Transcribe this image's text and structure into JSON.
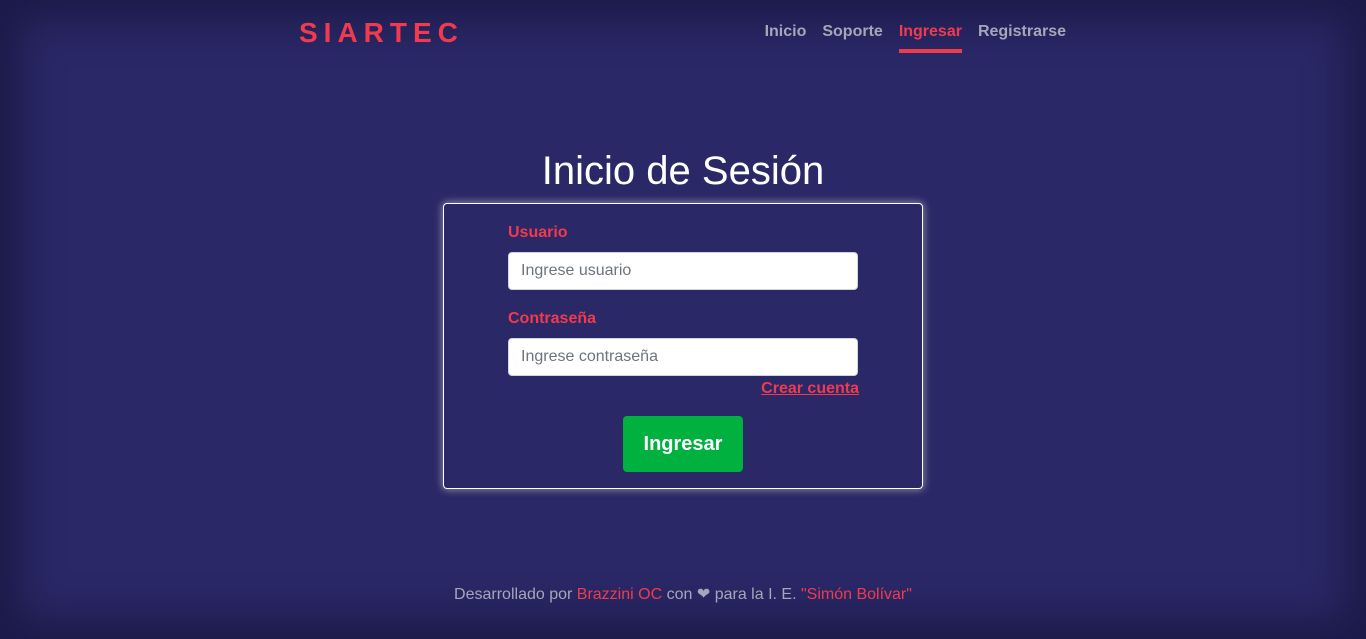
{
  "header": {
    "brand": "SIARTEC",
    "nav": [
      {
        "label": "Inicio",
        "active": false
      },
      {
        "label": "Soporte",
        "active": false
      },
      {
        "label": "Ingresar",
        "active": true
      },
      {
        "label": "Registrarse",
        "active": false
      }
    ]
  },
  "main": {
    "title": "Inicio de Sesión",
    "form": {
      "username_label": "Usuario",
      "username_placeholder": "Ingrese usuario",
      "username_value": "",
      "password_label": "Contraseña",
      "password_placeholder": "Ingrese contraseña",
      "password_value": "",
      "create_account_link": "Crear cuenta",
      "submit_label": "Ingresar"
    }
  },
  "footer": {
    "prefix": "Desarrollado por",
    "author": "Brazzini OC",
    "middle": "con",
    "heart_icon": "❤",
    "suffix": "para la I. E.",
    "school": "\"Simón Bolívar\""
  },
  "colors": {
    "background": "#2a2866",
    "accent": "#f23a4e",
    "muted_text": "#a7a5b8",
    "submit": "#00b140"
  }
}
